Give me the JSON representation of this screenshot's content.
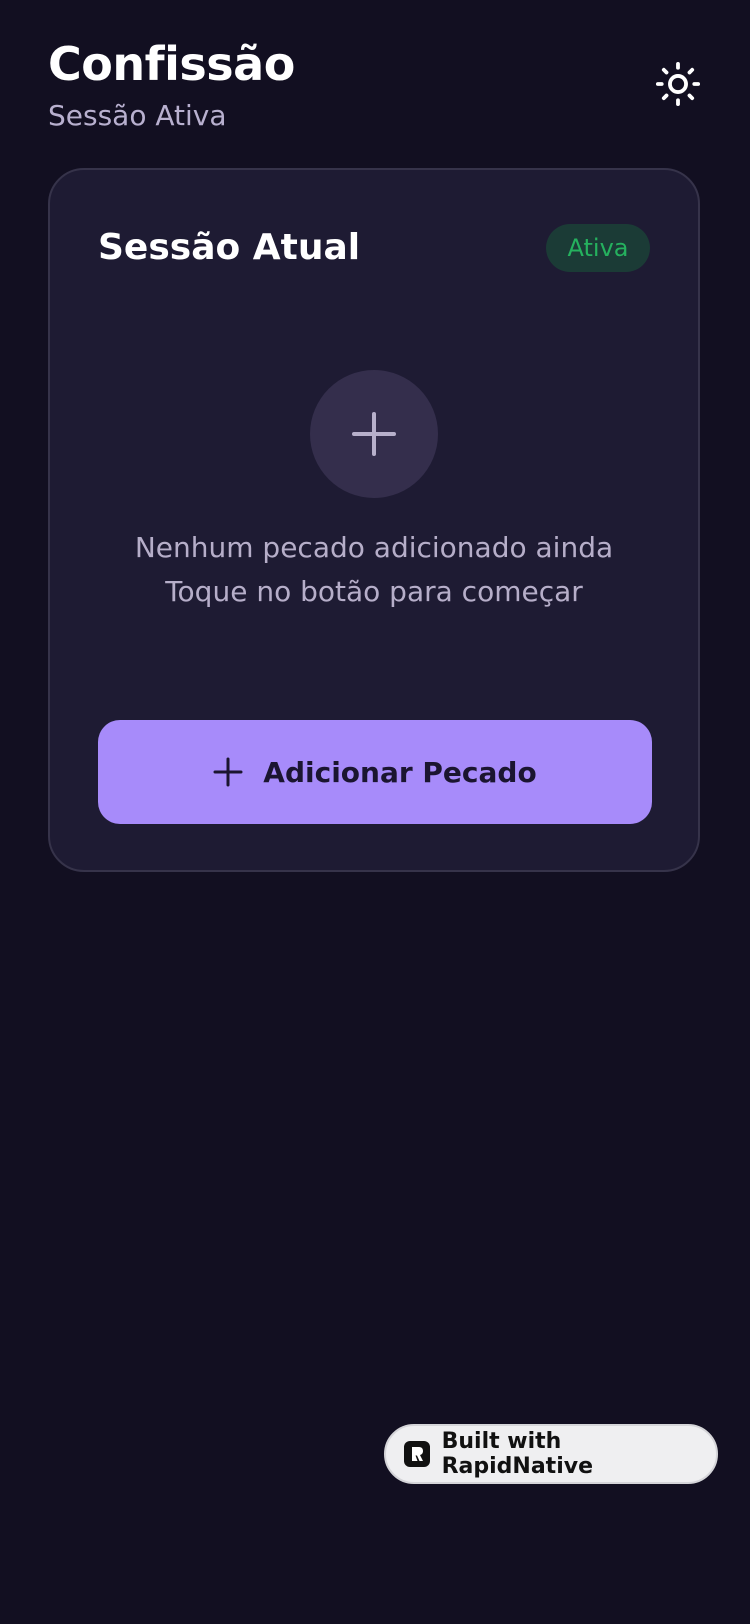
{
  "header": {
    "title": "Confissão",
    "subtitle": "Sessão Ativa",
    "theme_toggle_icon": "sun-icon"
  },
  "session_card": {
    "title": "Sessão Atual",
    "status_badge": "Ativa",
    "empty_state": {
      "icon": "plus-icon",
      "line1": "Nenhum pecado adicionado ainda",
      "line2": "Toque no botão para começar"
    },
    "add_button": {
      "icon": "plus-icon",
      "label": "Adicionar Pecado"
    }
  },
  "footer_badge": {
    "logo_icon": "rapidnative-logo-icon",
    "label": "Built with RapidNative"
  },
  "colors": {
    "background": "#120f21",
    "card": "#1e1b33",
    "accent": "#a78bfa",
    "status_green": "#25b15e"
  }
}
